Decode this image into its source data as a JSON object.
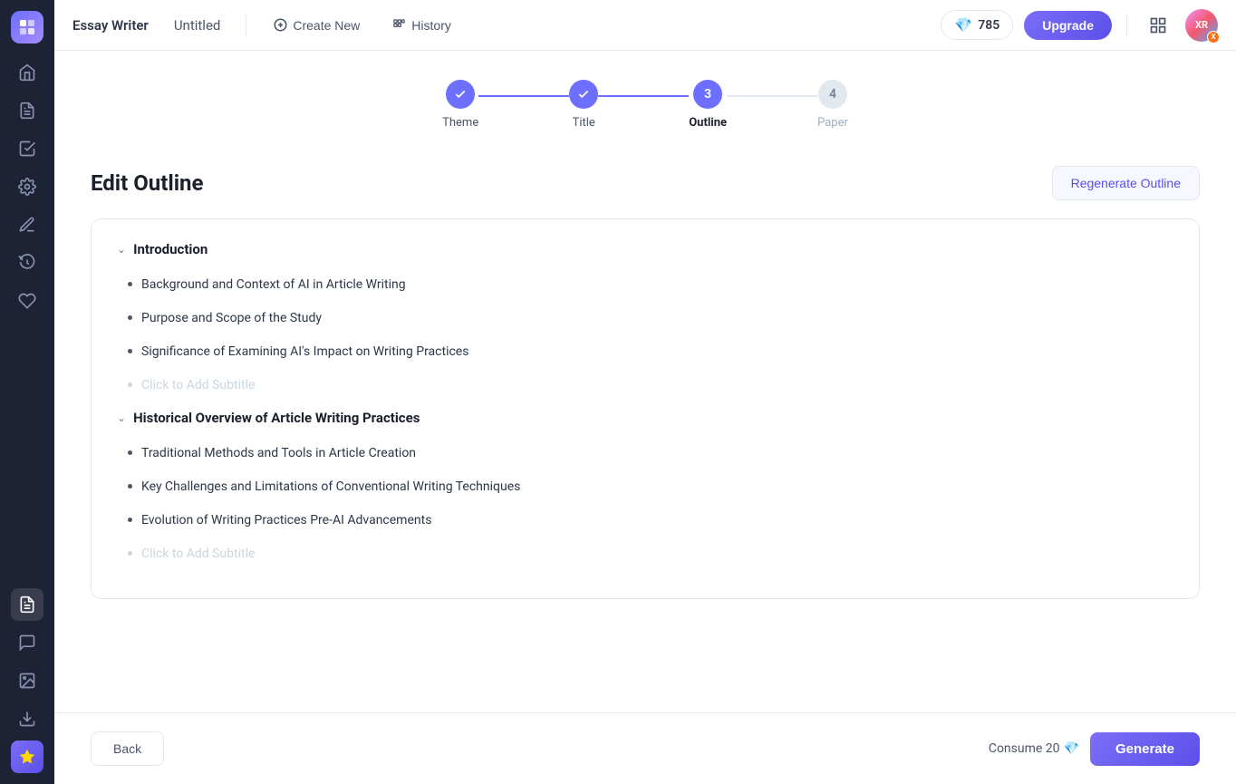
{
  "sidebar": {
    "logo_icon": "⊞",
    "items": [
      {
        "name": "home",
        "icon": "⌂",
        "active": false
      },
      {
        "name": "document",
        "icon": "☰",
        "active": false
      },
      {
        "name": "check",
        "icon": "✓",
        "active": false
      },
      {
        "name": "settings",
        "icon": "✦",
        "active": false
      },
      {
        "name": "pen",
        "icon": "✏",
        "active": false
      },
      {
        "name": "history",
        "icon": "◷",
        "active": false
      },
      {
        "name": "heart",
        "icon": "♡",
        "active": false
      }
    ],
    "bottom_items": [
      {
        "name": "essay-writer",
        "icon": "☰",
        "active": true
      },
      {
        "name": "chat",
        "icon": "💬",
        "active": false
      },
      {
        "name": "image",
        "icon": "⊡",
        "active": false
      },
      {
        "name": "download",
        "icon": "⬇",
        "active": false
      }
    ],
    "crown_icon": "♛"
  },
  "topbar": {
    "app_name": "Essay Writer",
    "doc_name": "Untitled",
    "create_new_label": "Create New",
    "history_label": "History",
    "credits": "785",
    "upgrade_label": "Upgrade"
  },
  "steps": [
    {
      "id": 1,
      "label": "Theme",
      "state": "completed",
      "icon": "✓"
    },
    {
      "id": 2,
      "label": "Title",
      "state": "completed",
      "icon": "✓"
    },
    {
      "id": 3,
      "label": "Outline",
      "state": "active",
      "icon": "3"
    },
    {
      "id": 4,
      "label": "Paper",
      "state": "inactive",
      "icon": "4"
    }
  ],
  "outline": {
    "page_title": "Edit Outline",
    "regenerate_label": "Regenerate Outline",
    "sections": [
      {
        "id": "intro",
        "title": "Introduction",
        "collapsed": false,
        "items": [
          "Background and Context of AI in Article Writing",
          "Purpose and Scope of the Study",
          "Significance of Examining AI's Impact on Writing Practices"
        ],
        "placeholder": "Click to Add Subtitle"
      },
      {
        "id": "historical",
        "title": "Historical Overview of Article Writing Practices",
        "collapsed": false,
        "items": [
          "Traditional Methods and Tools in Article Creation",
          "Key Challenges and Limitations of Conventional Writing Techniques",
          "Evolution of Writing Practices Pre-AI Advancements"
        ],
        "placeholder": "Click to Add Subtitle"
      }
    ]
  },
  "footer": {
    "back_label": "Back",
    "consume_label": "Consume 20",
    "generate_label": "Generate",
    "diamond_icon": "💎"
  }
}
